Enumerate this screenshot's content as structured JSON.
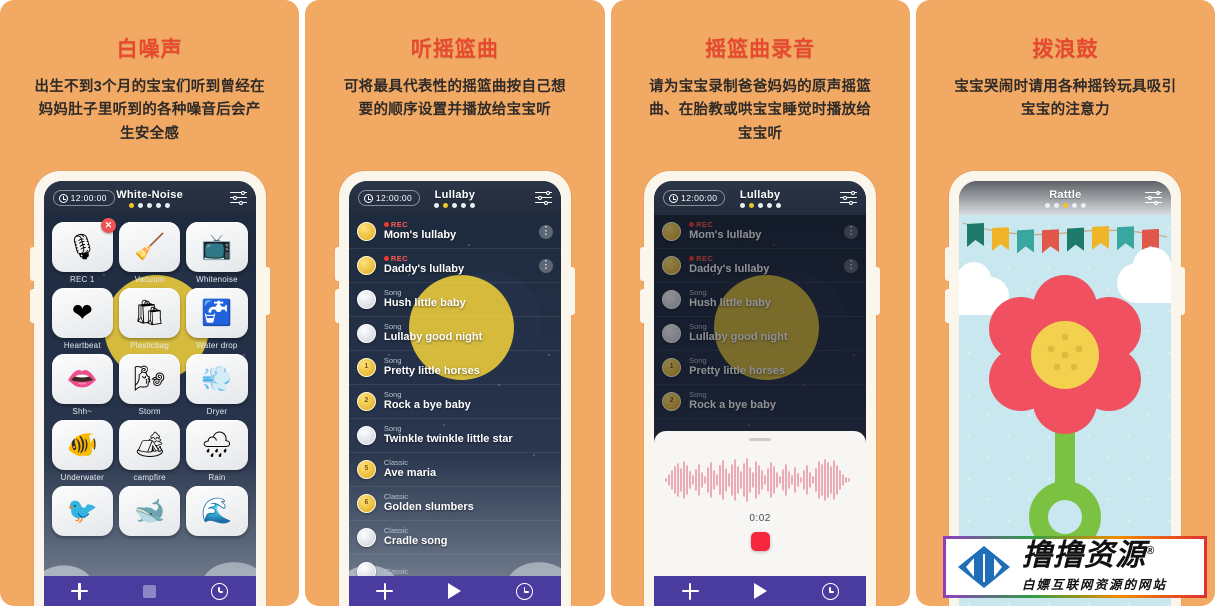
{
  "panels": [
    {
      "title": "白噪声",
      "desc": "出生不到3个月的宝宝们听到曾经在妈妈肚子里听到的各种噪音后会产生安全感",
      "app": {
        "screen_title": "White-Noise",
        "timer": "12:00:00",
        "active_dot": 0,
        "dot_count": 5,
        "settings_icon": "equalizer-icon",
        "clock_icon": "clock-icon"
      },
      "grid_tiles": [
        {
          "label": "REC 1",
          "icon": "microphone-icon",
          "glyph": "🎙",
          "badge": "✕"
        },
        {
          "label": "Vacuum",
          "icon": "vacuum-icon",
          "glyph": "🧹",
          "badge": ""
        },
        {
          "label": "Whitenoise",
          "icon": "tv-static-icon",
          "glyph": "📺",
          "badge": ""
        },
        {
          "label": "Heartbeat",
          "icon": "heartbeat-icon",
          "glyph": "❤",
          "badge": ""
        },
        {
          "label": "Plasticbag",
          "icon": "plasticbag-icon",
          "glyph": "🛍",
          "badge": ""
        },
        {
          "label": "Water drop",
          "icon": "faucet-icon",
          "glyph": "🚰",
          "badge": ""
        },
        {
          "label": "Shh~",
          "icon": "lips-icon",
          "glyph": "👄",
          "badge": ""
        },
        {
          "label": "Storm",
          "icon": "storm-icon",
          "glyph": "🌬",
          "badge": ""
        },
        {
          "label": "Dryer",
          "icon": "hairdryer-icon",
          "glyph": "💨",
          "badge": ""
        },
        {
          "label": "Underwater",
          "icon": "underwater-icon",
          "glyph": "🐠",
          "badge": ""
        },
        {
          "label": "campfire",
          "icon": "campfire-icon",
          "glyph": "🏕",
          "badge": ""
        },
        {
          "label": "Rain",
          "icon": "rain-cloud-icon",
          "glyph": "🌧",
          "badge": ""
        },
        {
          "label": "",
          "icon": "bird-icon",
          "glyph": "🐦",
          "badge": ""
        },
        {
          "label": "",
          "icon": "whale-icon",
          "glyph": "🐋",
          "badge": ""
        },
        {
          "label": "",
          "icon": "wave-icon",
          "glyph": "🌊",
          "badge": ""
        }
      ],
      "nav": [
        {
          "icon": "plus-icon",
          "kind": "plus"
        },
        {
          "icon": "stop-icon",
          "kind": "stop"
        },
        {
          "icon": "clock-icon",
          "kind": "clock"
        }
      ]
    },
    {
      "title": "听摇篮曲",
      "desc": "可将最具代表性的摇篮曲按自己想要的顺序设置并播放给宝宝听",
      "app": {
        "screen_title": "Lullaby",
        "timer": "12:00:00",
        "active_dot": 1,
        "dot_count": 5,
        "settings_icon": "equalizer-icon",
        "clock_icon": "clock-icon"
      },
      "songs": [
        {
          "kind": "REC",
          "is_rec": true,
          "name": "Mom's lullaby",
          "badge": "",
          "coin": "gold",
          "menu": true
        },
        {
          "kind": "REC",
          "is_rec": true,
          "name": "Daddy's lullaby",
          "badge": "",
          "coin": "gold",
          "menu": true
        },
        {
          "kind": "Song",
          "is_rec": false,
          "name": "Hush little baby",
          "badge": "",
          "coin": "silver",
          "menu": false
        },
        {
          "kind": "Song",
          "is_rec": false,
          "name": "Lullaby good night",
          "badge": "",
          "coin": "silver",
          "menu": false
        },
        {
          "kind": "Song",
          "is_rec": false,
          "name": "Pretty little horses",
          "badge": "1",
          "coin": "gold",
          "menu": false
        },
        {
          "kind": "Song",
          "is_rec": false,
          "name": "Rock a bye baby",
          "badge": "2",
          "coin": "gold",
          "menu": false
        },
        {
          "kind": "Song",
          "is_rec": false,
          "name": "Twinkle twinkle little star",
          "badge": "",
          "coin": "silver",
          "menu": false
        },
        {
          "kind": "Classic",
          "is_rec": false,
          "name": "Ave maria",
          "badge": "5",
          "coin": "gold",
          "menu": false
        },
        {
          "kind": "Classic",
          "is_rec": false,
          "name": "Golden slumbers",
          "badge": "6",
          "coin": "gold",
          "menu": false
        },
        {
          "kind": "Classic",
          "is_rec": false,
          "name": "Cradle song",
          "badge": "",
          "coin": "silver",
          "menu": false
        },
        {
          "kind": "Classic",
          "is_rec": false,
          "name": "",
          "badge": "",
          "coin": "silver",
          "menu": false
        }
      ],
      "nav": [
        {
          "icon": "plus-icon",
          "kind": "plus"
        },
        {
          "icon": "play-icon",
          "kind": "play"
        },
        {
          "icon": "clock-icon",
          "kind": "clock"
        }
      ]
    },
    {
      "title": "摇篮曲录音",
      "desc": "请为宝宝录制爸爸妈妈的原声摇篮曲、在胎教或哄宝宝睡觉时播放给宝宝听",
      "app": {
        "screen_title": "Lullaby",
        "timer": "12:00:00",
        "active_dot": 1,
        "dot_count": 5,
        "settings_icon": "equalizer-icon",
        "clock_icon": "clock-icon"
      },
      "songs": [
        {
          "kind": "REC",
          "is_rec": true,
          "name": "Mom's lullaby",
          "badge": "",
          "coin": "gold",
          "menu": true
        },
        {
          "kind": "REC",
          "is_rec": true,
          "name": "Daddy's lullaby",
          "badge": "",
          "coin": "gold",
          "menu": true
        },
        {
          "kind": "Song",
          "is_rec": false,
          "name": "Hush little baby",
          "badge": "",
          "coin": "silver",
          "menu": false
        },
        {
          "kind": "Song",
          "is_rec": false,
          "name": "Lullaby good night",
          "badge": "",
          "coin": "silver",
          "menu": false
        },
        {
          "kind": "Song",
          "is_rec": false,
          "name": "Pretty little horses",
          "badge": "1",
          "coin": "gold",
          "menu": false
        },
        {
          "kind": "Song",
          "is_rec": false,
          "name": "Rock a bye baby",
          "badge": "2",
          "coin": "gold",
          "menu": false
        }
      ],
      "recorder": {
        "elapsed": "0:02",
        "stop_button_icon": "record-stop-icon",
        "waveform_color": "#e8899a",
        "grabber": "sheet-handle"
      },
      "nav": [
        {
          "icon": "plus-icon",
          "kind": "plus"
        },
        {
          "icon": "play-icon",
          "kind": "play"
        },
        {
          "icon": "clock-icon",
          "kind": "clock"
        }
      ]
    },
    {
      "title": "拨浪鼓",
      "desc": "宝宝哭闹时请用各种摇铃玩具吸引宝宝的注意力",
      "app": {
        "screen_title": "Rattle",
        "timer": "",
        "active_dot": 2,
        "dot_count": 5,
        "settings_icon": "equalizer-icon",
        "clock_icon": "clock-icon"
      },
      "toy": {
        "name": "flower-rattle-toy",
        "petal_color": "#f0505f",
        "center_color": "#f3d04e",
        "stem_color": "#7cc242"
      },
      "bunting_colors": [
        "#1f7a6b",
        "#f0b429",
        "#3aa6a0",
        "#e2574c",
        "#1f7a6b",
        "#f0b429",
        "#3aa6a0",
        "#e2574c"
      ]
    }
  ],
  "watermark": {
    "main": "撸撸资源",
    "registered": "®",
    "sub": "白嫖互联网资源的网站",
    "logo_icon": "diamond-arrows-logo"
  },
  "colors": {
    "panel_bg": "#f2a964",
    "title_red": "#e8492e",
    "navbar_purple": "#4a3c9e",
    "accent_yellow": "#f2c327",
    "rec_red": "#ef3a2c"
  }
}
